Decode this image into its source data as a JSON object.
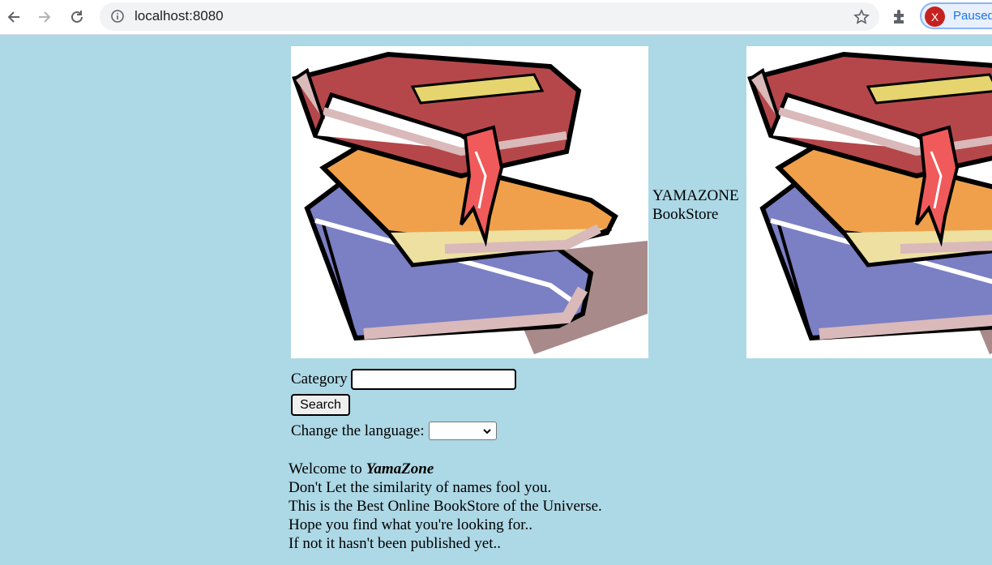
{
  "browser": {
    "url": "localhost:8080",
    "profile_initial": "X",
    "profile_status": "Paused"
  },
  "page": {
    "store_name_line1": "YAMAZONE",
    "store_name_line2": "BookStore",
    "category_label": "Category",
    "category_value": "",
    "search_button": "Search",
    "language_label": "Change the language:",
    "language_value": "",
    "welcome_prefix": "Welcome to ",
    "welcome_brand": "YamaZone",
    "lines": [
      "Don't Let the similarity of names fool you.",
      "This is the Best Online BookStore of the Universe.",
      "Hope you find what you're looking for..",
      "If not it hasn't been published yet.."
    ]
  },
  "colors": {
    "page_background": "#add8e6",
    "book_red": "#b5474b",
    "book_orange": "#f0a04b",
    "book_blue": "#7b7fc4",
    "bookmark": "#f05a5a"
  }
}
